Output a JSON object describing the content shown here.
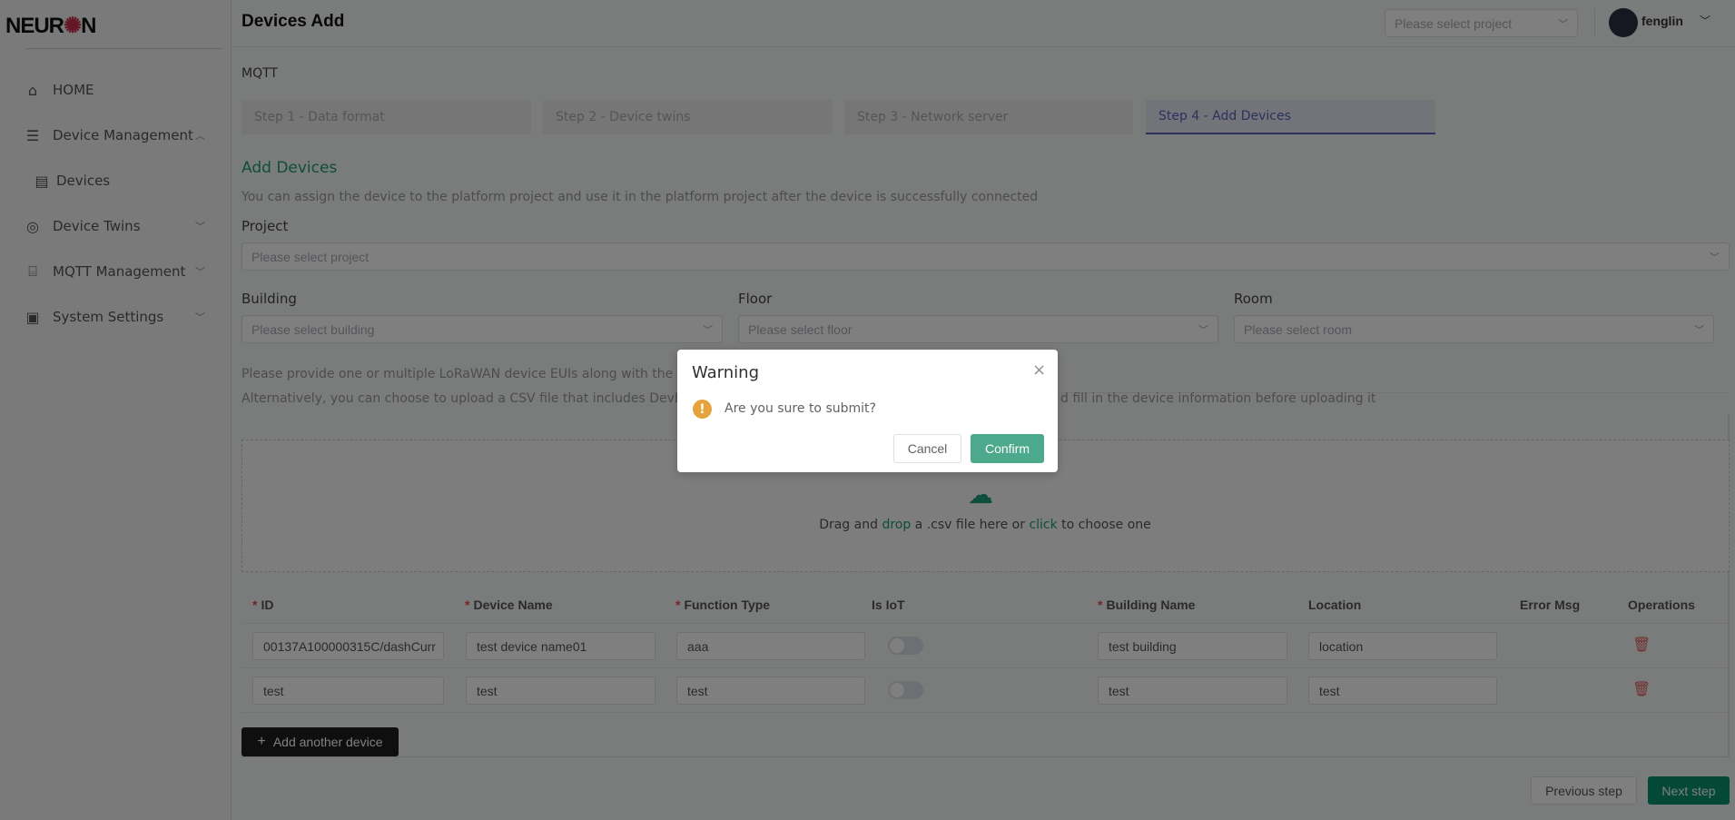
{
  "app": {
    "logo": "NEURON"
  },
  "sidebar": {
    "items": [
      {
        "label": "HOME",
        "icon": "home-icon"
      },
      {
        "label": "Device Management",
        "icon": "server-icon",
        "expanded": true
      },
      {
        "label": "Devices",
        "icon": "devices-icon"
      },
      {
        "label": "Device Twins",
        "icon": "twins-icon"
      },
      {
        "label": "MQTT Management",
        "icon": "router-icon"
      },
      {
        "label": "System Settings",
        "icon": "monitor-icon"
      }
    ]
  },
  "header": {
    "title": "Devices Add",
    "project_placeholder": "Please select project",
    "user": "fenglin"
  },
  "main": {
    "protocol": "MQTT",
    "steps": [
      "Step 1 - Data format",
      "Step 2 - Device twins",
      "Step 3 - Network server",
      "Step 4 - Add Devices"
    ],
    "active_step": 4,
    "section_title": "Add Devices",
    "description": "You can assign the device to the platform project and use it in the platform project after the device is successfully connected",
    "project_label": "Project",
    "project_placeholder": "Please select project",
    "building_label": "Building",
    "building_placeholder": "Please select building",
    "floor_label": "Floor",
    "floor_placeholder": "Please select floor",
    "room_label": "Room",
    "room_placeholder": "Please select room",
    "hint_line1": "Please provide one or multiple LoRaWAN device EUIs along with the corres",
    "hint_line2_start": "Alternatively, you can choose to upload a CSV file that includes DevEUI, de",
    "hint_line2_end": "d fill in the device information before uploading it",
    "upload": {
      "t1": "Drag and ",
      "drop": "drop",
      "t2": " a .csv file here or ",
      "click": "click",
      "t3": " to choose one"
    },
    "table": {
      "headers": {
        "id": "ID",
        "name": "Device Name",
        "func": "Function Type",
        "iot": "Is IoT",
        "building": "Building Name",
        "location": "Location",
        "error": "Error Msg",
        "ops": "Operations"
      },
      "rows": [
        {
          "id": "00137A100000315C/dashCurr",
          "name": "test device name01",
          "func": "aaa",
          "iot": false,
          "building": "test building",
          "location": "location"
        },
        {
          "id": "test",
          "name": "test",
          "func": "test",
          "iot": false,
          "building": "test",
          "location": "test"
        }
      ]
    },
    "add_device": "Add another device",
    "prev": "Previous step",
    "next": "Next step"
  },
  "modal": {
    "title": "Warning",
    "message": "Are you sure to submit?",
    "cancel": "Cancel",
    "confirm": "Confirm"
  },
  "colors": {
    "accent": "#4ca98b",
    "warning": "#e6a23c",
    "brand_dark": "#07936d"
  }
}
